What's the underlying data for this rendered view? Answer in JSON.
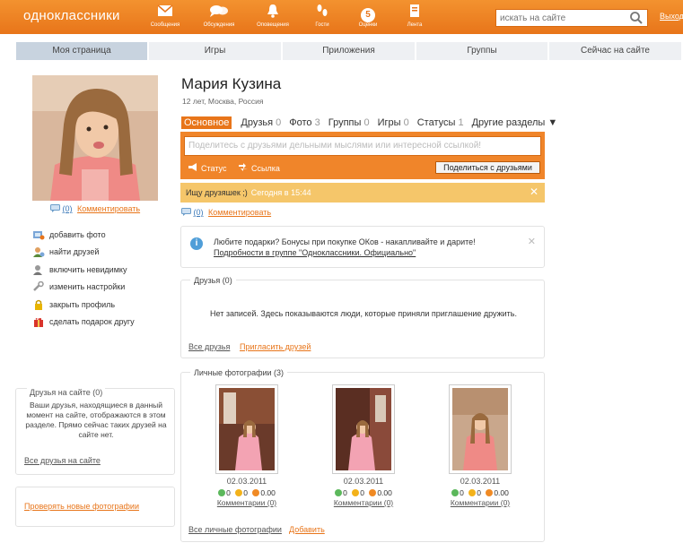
{
  "header": {
    "logo": "одноклассники",
    "nav": [
      {
        "label": "Сообщения",
        "icon": "envelope-icon"
      },
      {
        "label": "Обсуждения",
        "icon": "chat-bubbles-icon"
      },
      {
        "label": "Оповещения",
        "icon": "bell-icon"
      },
      {
        "label": "Гости",
        "icon": "footprints-icon"
      },
      {
        "label": "Оценки",
        "icon": "rating-badge-icon",
        "badge": "5"
      },
      {
        "label": "Лента",
        "icon": "feed-icon"
      }
    ],
    "search_placeholder": "искать на сайте",
    "logout": "Выход"
  },
  "tabs": [
    "Моя страница",
    "Игры",
    "Приложения",
    "Группы",
    "Сейчас на сайте"
  ],
  "profile": {
    "name": "Мария Кузина",
    "info": "12 лет, Москва, Россия",
    "sections": [
      {
        "label": "Основное",
        "count": ""
      },
      {
        "label": "Друзья",
        "count": "0"
      },
      {
        "label": "Фото",
        "count": "3"
      },
      {
        "label": "Группы",
        "count": "0"
      },
      {
        "label": "Игры",
        "count": "0"
      },
      {
        "label": "Статусы",
        "count": "1"
      },
      {
        "label": "Другие разделы ▼",
        "count": ""
      }
    ]
  },
  "left": {
    "comment_count": "(0)",
    "comment_link": "Комментировать",
    "actions": [
      "добавить фото",
      "найти друзей",
      "включить невидимку",
      "изменить настройки",
      "закрыть профиль",
      "сделать подарок другу"
    ],
    "friends_online": {
      "title": "Друзья на сайте (0)",
      "text": "Ваши друзья, находящиеся в данный момент на сайте, отображаются в этом разделе. Прямо сейчас таких друзей на сайте нет.",
      "link": "Все друзья на сайте"
    },
    "check_photos": "Проверять новые фотографии"
  },
  "share": {
    "placeholder": "Поделитесь с друзьями дельными мыслями или интересной ссылкой!",
    "status_label": "Статус",
    "link_label": "Ссылка",
    "button": "Поделиться с друзьями"
  },
  "status": {
    "text": "Ищу друзяшек ;)",
    "time": "Сегодня в 15:44",
    "close": "✕",
    "comment_count": "(0)",
    "comment_link": "Комментировать"
  },
  "promo": {
    "line1": "Любите подарки? Бонусы при покупке ОКов - накапливайте и дарите!",
    "line2": "Подробности в группе \"Одноклассники. Официально\"",
    "close": "✕"
  },
  "friends": {
    "title": "Друзья (0)",
    "empty": "Нет записей. Здесь показываются люди, которые приняли приглашение дружить.",
    "all": "Все друзья",
    "invite": "Пригласить друзей"
  },
  "photos": {
    "title": "Личные фотографии (3)",
    "items": [
      {
        "date": "02.03.2011",
        "m1": "0",
        "m2": "0",
        "m3": "0.00",
        "comments": "Комментарии (0)"
      },
      {
        "date": "02.03.2011",
        "m1": "0",
        "m2": "0",
        "m3": "0.00",
        "comments": "Комментарии (0)"
      },
      {
        "date": "02.03.2011",
        "m1": "0",
        "m2": "0",
        "m3": "0.00",
        "comments": "Комментарии (0)"
      }
    ],
    "all": "Все личные фотографии",
    "add": "Добавить"
  },
  "colors": {
    "brand": "#e8751a",
    "status_bar": "#f5c66a",
    "tab_active": "#c8d3df"
  }
}
